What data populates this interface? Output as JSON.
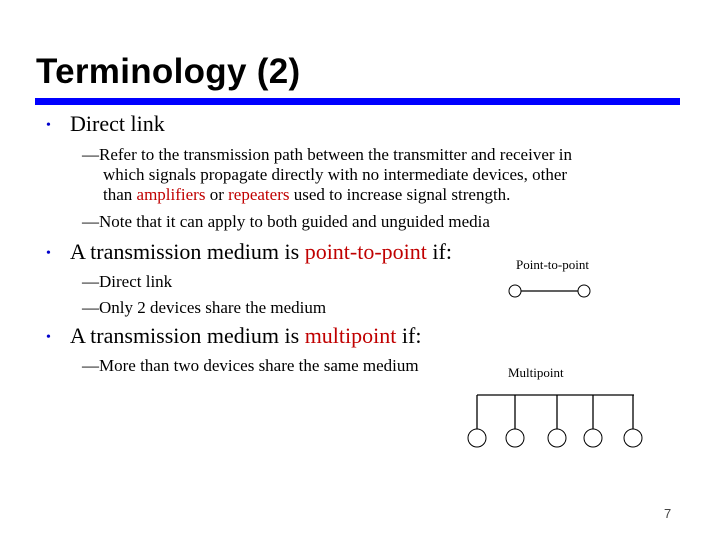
{
  "slide": {
    "title": "Terminology (2)",
    "accent_color": "#0000ff",
    "highlight_color": "#c00000",
    "page_number": "7"
  },
  "bullets": [
    {
      "text": "Direct link",
      "subitems": [
        {
          "parts": {
            "line1": "Refer to the transmission path between the transmitter and receiver in",
            "line2": "which signals propagate directly with no intermediate devices, other",
            "line3_a": "than ",
            "line3_b": "amplifiers",
            "line3_c": " or ",
            "line3_d": "repeaters",
            "line3_e": " used to increase signal strength."
          }
        },
        {
          "text": "Note that it can apply to both guided and unguided media"
        }
      ]
    },
    {
      "text_a": "A transmission medium is ",
      "text_b": "point-to-point",
      "text_c": " if:",
      "subitems": [
        {
          "text": "Direct link"
        },
        {
          "text": "Only 2 devices share the medium"
        }
      ]
    },
    {
      "text_a": "A transmission medium is ",
      "text_b": "multipoint",
      "text_c": " if:",
      "subitems": [
        {
          "text": "More than two devices share the same medium"
        }
      ]
    }
  ],
  "bullet_glyph": "•",
  "dash_glyph": "—",
  "diagrams": {
    "point_to_point": {
      "label": "Point-to-point",
      "nodes": 2
    },
    "multipoint": {
      "label": "Multipoint",
      "nodes": 5
    }
  }
}
